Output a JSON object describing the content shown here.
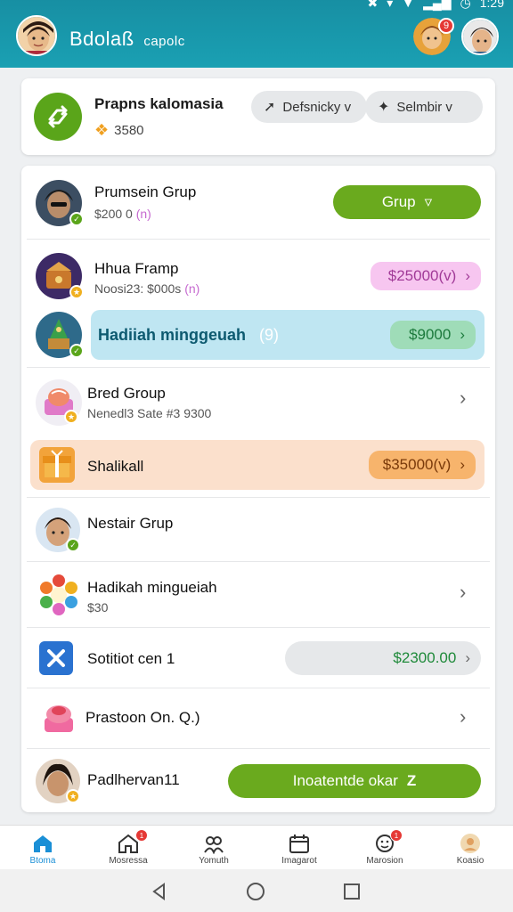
{
  "status": {
    "time": "1:29"
  },
  "header": {
    "title": "Bdolaß",
    "subtitle": "capolc",
    "notification_count": "9"
  },
  "profile": {
    "name": "Prapns kalomasia",
    "coins": "3580",
    "pills": [
      {
        "label": "Defsnicky v",
        "icon": "pin-icon"
      },
      {
        "label": "Selmbir v",
        "icon": "puzzle-icon"
      }
    ]
  },
  "list": {
    "rows": [
      {
        "title": "Prumsein Grup",
        "sub": "$200 0",
        "sub_tag": "(n)",
        "button": "Grup"
      },
      {
        "title": "Hhua Framp",
        "sub": "Noosi23: $000s",
        "sub_tag": "(n)",
        "price": "$25000(v)"
      },
      {
        "title": "Hadiiah minggeuah",
        "title_tag": "(9)",
        "price": "$9000"
      },
      {
        "title": "Bred Group",
        "sub": "Nenedl3 Sate #3 9300"
      },
      {
        "title": "Shalikall",
        "price": "$35000(v)"
      },
      {
        "title": "Nestair Grup"
      },
      {
        "title": "Hadikah mingueiah",
        "sub": "$30"
      },
      {
        "title": "Sotitiot cen 1",
        "price": "$2300.00"
      },
      {
        "title": "Prastoon On. Q.)"
      },
      {
        "title": "Padlhervan11",
        "button": "Inoatentde okar"
      }
    ]
  },
  "nav": {
    "items": [
      {
        "label": "Btoma",
        "icon": "home-icon",
        "active": true
      },
      {
        "label": "Mosressa",
        "icon": "home-outline-icon",
        "badge": "1"
      },
      {
        "label": "Yomuth",
        "icon": "group-icon"
      },
      {
        "label": "Imagarot",
        "icon": "calendar-icon"
      },
      {
        "label": "Marosion",
        "icon": "settings-face-icon",
        "badge": "1"
      },
      {
        "label": "Koasio",
        "icon": "profile-icon"
      }
    ]
  }
}
